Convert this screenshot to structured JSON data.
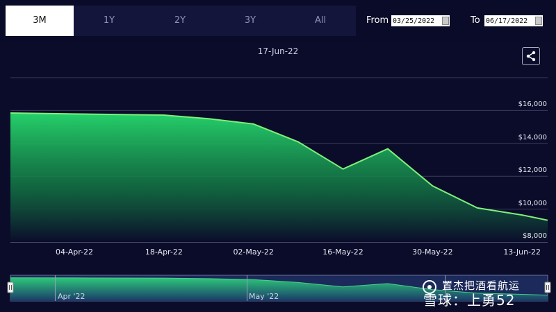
{
  "tabs": [
    {
      "label": "3M",
      "active": true
    },
    {
      "label": "1Y",
      "active": false
    },
    {
      "label": "2Y",
      "active": false
    },
    {
      "label": "3Y",
      "active": false
    },
    {
      "label": "All",
      "active": false
    }
  ],
  "range": {
    "from_label": "From",
    "from_value": "03/25/2022",
    "to_label": "To",
    "to_value": "06/17/2022"
  },
  "header_date": "17-Jun-22",
  "icons": {
    "share": "share-icon"
  },
  "navigator": {
    "labels": [
      "Apr '22",
      "May '22"
    ]
  },
  "watermark": "雪球：上勇52",
  "watermark_top": "置杰把酒看航运",
  "colors": {
    "area_top": "#25d06a",
    "area_bottom": "#0b0c2a",
    "line": "#7ef07a",
    "grid": "#3a3d5e"
  },
  "chart_data": {
    "type": "area",
    "title": "",
    "xlabel": "",
    "ylabel": "",
    "x": [
      "2022-03-25",
      "2022-04-04",
      "2022-04-18",
      "2022-04-25",
      "2022-05-02",
      "2022-05-09",
      "2022-05-16",
      "2022-05-23",
      "2022-05-30",
      "2022-06-06",
      "2022-06-13",
      "2022-06-17"
    ],
    "series": [
      {
        "values": [
          15850,
          15790,
          15720,
          15500,
          15180,
          14090,
          12440,
          13670,
          11410,
          10070,
          9640,
          9320
        ]
      }
    ],
    "ylim": [
      8000,
      18000
    ],
    "yticks": [
      8000,
      10000,
      12000,
      14000,
      16000
    ],
    "ytick_labels": [
      "$8,000",
      "$10,000",
      "$12,000",
      "$14,000",
      "$16,000"
    ],
    "xtick_dates": [
      "2022-04-04",
      "2022-04-18",
      "2022-05-02",
      "2022-05-16",
      "2022-05-30",
      "2022-06-13"
    ],
    "xtick_labels": [
      "04-Apr-22",
      "18-Apr-22",
      "02-May-22",
      "16-May-22",
      "30-May-22",
      "13-Jun-22"
    ],
    "grid": true,
    "legend": "none"
  }
}
